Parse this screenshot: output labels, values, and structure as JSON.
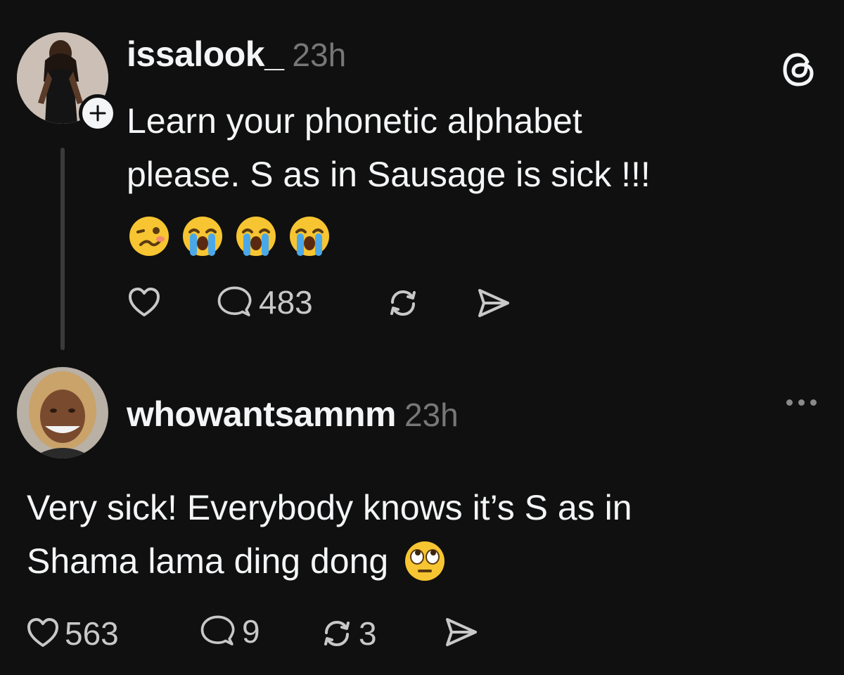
{
  "post": {
    "username": "issalook_",
    "time": "23h",
    "text_line1": "Learn your phonetic alphabet",
    "text_line2": "please. S as in Sausage is sick !!!",
    "emojis": [
      "woozy-face-emoji",
      "loudly-crying-face-emoji",
      "loudly-crying-face-emoji",
      "loudly-crying-face-emoji"
    ],
    "reply_count": "483"
  },
  "reply": {
    "username": "whowantsamnm",
    "time": "23h",
    "text_line1": "Very sick! Everybody knows it’s S as in",
    "text_line2": "Shama lama ding dong",
    "emoji": "face-with-rolling-eyes-emoji",
    "like_count": "563",
    "reply_count": "9",
    "repost_count": "3"
  },
  "colors": {
    "background": "#101010",
    "text": "#f3f5f7",
    "secondary": "#777777",
    "icon": "#c8c8c8"
  }
}
